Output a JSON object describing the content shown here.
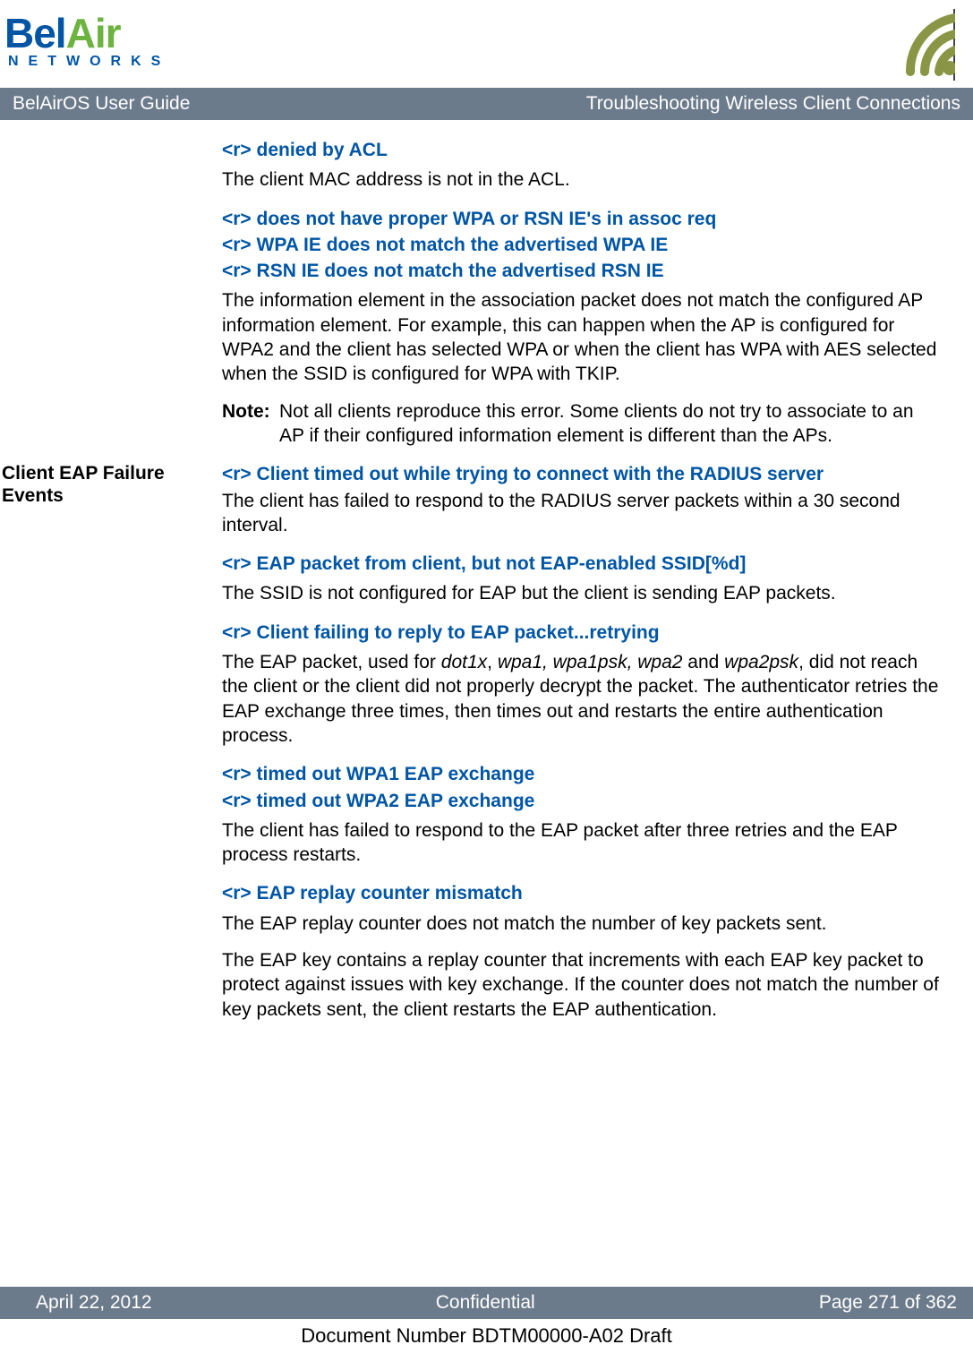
{
  "logo": {
    "part1": "Bel",
    "part2": "Air",
    "subtitle": "NETWORKS"
  },
  "titlebar": {
    "left": "BelAirOS User Guide",
    "right": "Troubleshooting Wireless Client Connections"
  },
  "sidebar": {
    "heading": "Client EAP Failure Events"
  },
  "sections": {
    "s1_h": "<r> denied by ACL",
    "s1_b": "The client MAC address is not in the ACL.",
    "s2_h1": "<r> does not have proper WPA or RSN IE's in assoc req",
    "s2_h2": "<r> WPA IE does not match the advertised WPA IE",
    "s2_h3": "<r> RSN IE does not match the advertised RSN IE",
    "s2_b": "The information element in the association packet does not match the configured AP information element. For example, this can happen when the AP is configured for WPA2 and the client has selected WPA or when the client has WPA with AES selected when the SSID is configured for WPA with TKIP.",
    "note_label": "Note:",
    "note_text": "Not all clients reproduce this error. Some clients do not try to associate to an AP if their configured information element is different than the APs.",
    "s3_h": "<r> Client timed out while trying to connect with the RADIUS server",
    "s3_b": "The client has failed to respond to the RADIUS server packets within a 30 second interval.",
    "s4_h": "<r> EAP packet from client, but not EAP-enabled SSID[%d]",
    "s4_b": "The SSID is not configured for EAP but the client is sending EAP packets.",
    "s5_h": "<r> Client failing to reply to EAP packet...retrying",
    "s5_b_pre": "The EAP packet, used for ",
    "s5_b_t1": "dot1x",
    "s5_b_sep1": ", ",
    "s5_b_t2": "wpa1, wpa1psk, wpa2",
    "s5_b_sep2": " and ",
    "s5_b_t3": "wpa2psk",
    "s5_b_post": ", did not reach the client or the client did not properly decrypt the packet. The authenticator retries the EAP exchange three times, then times out and restarts the entire authentication process.",
    "s6_h1": "<r> timed out WPA1 EAP exchange",
    "s6_h2": "<r> timed out WPA2 EAP exchange",
    "s6_b": "The client has failed to respond to the EAP packet after three retries and the EAP process restarts.",
    "s7_h": "<r> EAP replay counter mismatch",
    "s7_b1": "The EAP replay counter does not match the number of key packets sent.",
    "s7_b2": "The EAP key contains a replay counter that increments with each EAP key packet to protect against issues with key exchange. If the counter does not match the number of key packets sent, the client restarts the EAP authentication."
  },
  "footer": {
    "left": "April 22, 2012",
    "center": "Confidential",
    "right": "Page 271 of 362"
  },
  "docnumber": "Document Number BDTM00000-A02 Draft"
}
